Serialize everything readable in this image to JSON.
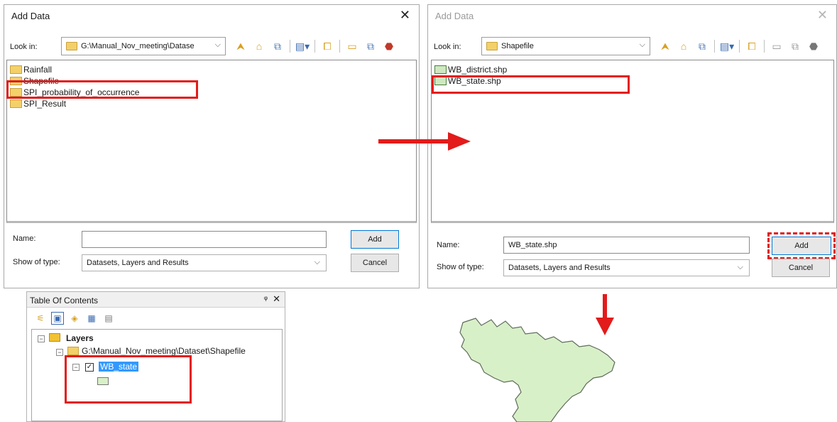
{
  "left_dialog": {
    "title": "Add Data",
    "close": "✕",
    "look_in_label": "Look in:",
    "look_in_value": "G:\\Manual_Nov_meeting\\Datase",
    "items": [
      "Rainfall",
      "Shapefile",
      "SPI_probability_of_occurrence",
      "SPI_Result"
    ],
    "name_label": "Name:",
    "name_value": "",
    "type_label": "Show of type:",
    "type_value": "Datasets, Layers and Results",
    "add_label": "Add",
    "cancel_label": "Cancel"
  },
  "right_dialog": {
    "title": "Add Data",
    "close": "✕",
    "look_in_label": "Look in:",
    "look_in_value": "Shapefile",
    "items": [
      "WB_district.shp",
      "WB_state.shp"
    ],
    "name_label": "Name:",
    "name_value": "WB_state.shp",
    "type_label": "Show of type:",
    "type_value": "Datasets, Layers and Results",
    "add_label": "Add",
    "cancel_label": "Cancel"
  },
  "toc": {
    "title": "Table Of Contents",
    "pin": "ᵠ",
    "close": "✕",
    "layers_label": "Layers",
    "path": "G:\\Manual_Nov_meeting\\Dataset\\Shapefile",
    "layer_name": "WB_state"
  },
  "colors": {
    "highlight": "#e31b1b",
    "map_fill": "#d8f0c8",
    "map_stroke": "#5f6b5b",
    "selection": "#3399ff"
  }
}
